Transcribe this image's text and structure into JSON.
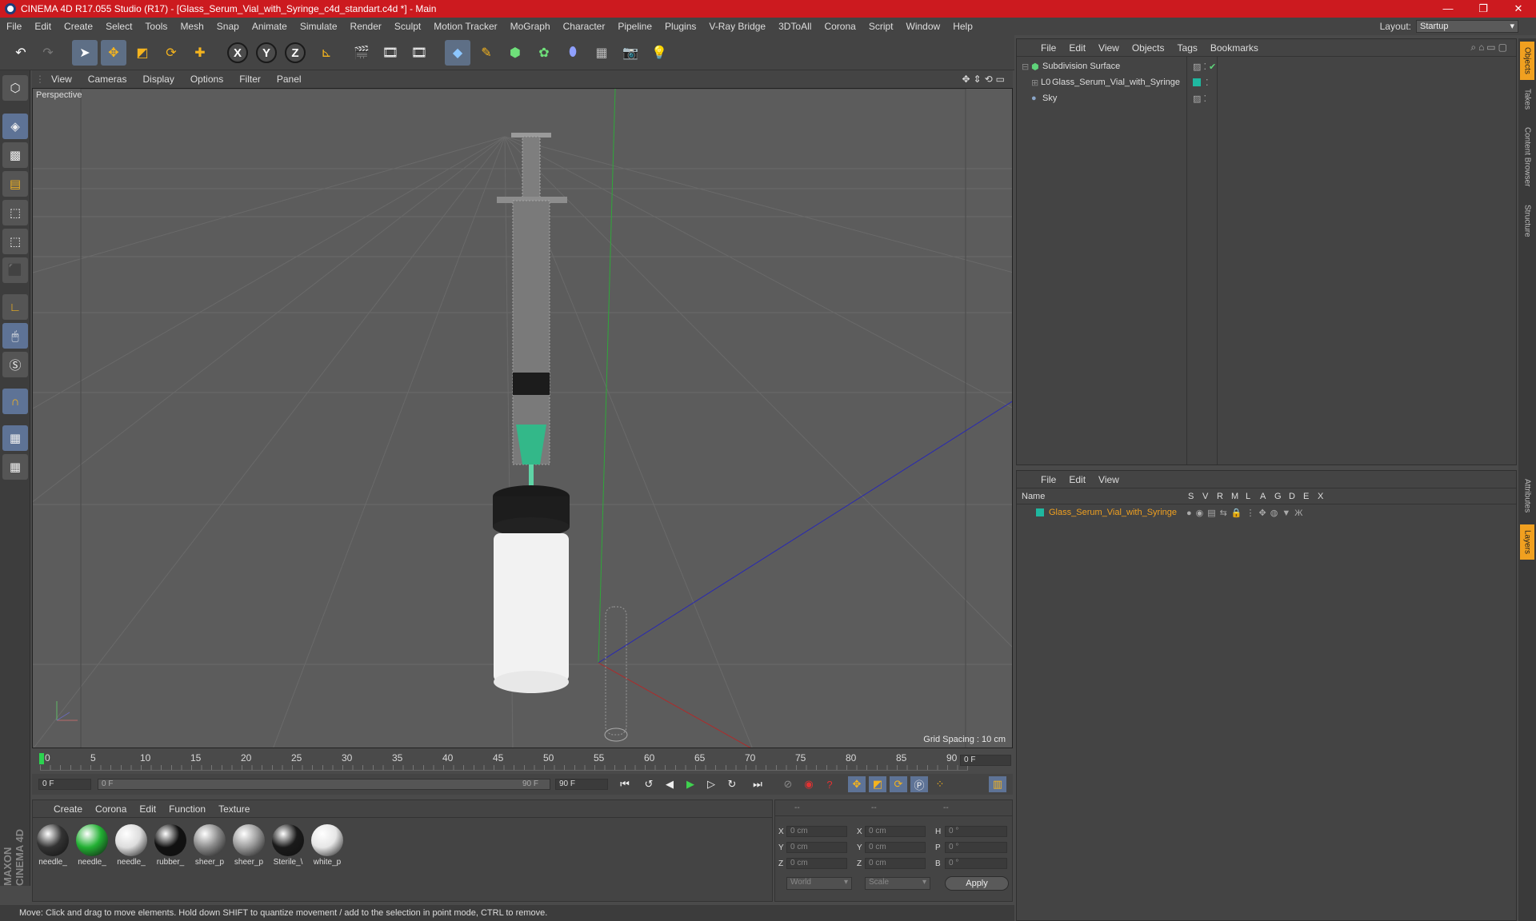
{
  "titlebar": {
    "title": "CINEMA 4D R17.055 Studio (R17) - [Glass_Serum_Vial_with_Syringe_c4d_standart.c4d *] - Main",
    "minimize": "—",
    "maximize": "❐",
    "close": "✕"
  },
  "menubar": {
    "items": [
      "File",
      "Edit",
      "Create",
      "Select",
      "Tools",
      "Mesh",
      "Snap",
      "Animate",
      "Simulate",
      "Render",
      "Sculpt",
      "Motion Tracker",
      "MoGraph",
      "Character",
      "Pipeline",
      "Plugins",
      "V-Ray Bridge",
      "3DToAll",
      "Corona",
      "Script",
      "Window",
      "Help"
    ],
    "layout_label": "Layout:",
    "layout_value": "Startup"
  },
  "toolbar": {
    "undo": "↶",
    "redo": "↷",
    "axis_x": "X",
    "axis_y": "Y",
    "axis_z": "Z"
  },
  "viewport": {
    "menu": [
      "View",
      "Cameras",
      "Display",
      "Options",
      "Filter",
      "Panel"
    ],
    "label": "Perspective",
    "grid_spacing": "Grid Spacing : 10 cm"
  },
  "timeline": {
    "ticks": [
      "0",
      "5",
      "10",
      "15",
      "20",
      "25",
      "30",
      "35",
      "40",
      "45",
      "50",
      "55",
      "60",
      "65",
      "70",
      "75",
      "80",
      "85",
      "90"
    ],
    "frame_field": "0 F"
  },
  "playbar": {
    "start": "0 F",
    "range_start": "0 F",
    "range_end": "90 F",
    "end": "90 F"
  },
  "materials": {
    "menu": [
      "Create",
      "Corona",
      "Edit",
      "Function",
      "Texture"
    ],
    "items": [
      {
        "label": "needle_",
        "color": "#333333"
      },
      {
        "label": "needle_",
        "color": "#22b033"
      },
      {
        "label": "needle_",
        "color": "#dddddd"
      },
      {
        "label": "rubber_",
        "color": "#111111"
      },
      {
        "label": "sheer_p",
        "color": "#8a8a8a"
      },
      {
        "label": "sheer_p",
        "color": "#9a9a9a"
      },
      {
        "label": "Sterile_\\",
        "color": "#1a1a1a"
      },
      {
        "label": "white_p",
        "color": "#e6e6e6"
      }
    ]
  },
  "coords": {
    "header": [
      "--",
      "--",
      "--"
    ],
    "rows": [
      {
        "a": "X",
        "av": "0 cm",
        "b": "X",
        "bv": "0 cm",
        "c": "H",
        "cv": "0 °"
      },
      {
        "a": "Y",
        "av": "0 cm",
        "b": "Y",
        "bv": "0 cm",
        "c": "P",
        "cv": "0 °"
      },
      {
        "a": "Z",
        "av": "0 cm",
        "b": "Z",
        "bv": "0 cm",
        "c": "B",
        "cv": "0 °"
      }
    ],
    "world": "World",
    "scale": "Scale",
    "apply": "Apply"
  },
  "statusbar": {
    "text": "Move: Click and drag to move elements. Hold down SHIFT to quantize movement / add to the selection in point mode, CTRL to remove."
  },
  "objects": {
    "menu": [
      "File",
      "Edit",
      "View",
      "Objects",
      "Tags",
      "Bookmarks"
    ],
    "items": [
      {
        "name": "Subdivision Surface",
        "color": "#dddddd"
      },
      {
        "name": "Glass_Serum_Vial_with_Syringe",
        "color": "#dddddd"
      },
      {
        "name": "Sky",
        "color": "#dddddd"
      }
    ]
  },
  "layers": {
    "menu": [
      "File",
      "Edit",
      "View"
    ],
    "columns": [
      "Name",
      "S",
      "V",
      "R",
      "M",
      "L",
      "A",
      "G",
      "D",
      "E",
      "X"
    ],
    "items": [
      {
        "name": "Glass_Serum_Vial_with_Syringe",
        "color": "#f0a020",
        "swatch": "#1fb8a0"
      }
    ]
  },
  "right_tabs": [
    "Objects",
    "Takes",
    "Content Browser",
    "Structure",
    "Attributes",
    "Layers"
  ],
  "branding": "MAXON CINEMA 4D"
}
